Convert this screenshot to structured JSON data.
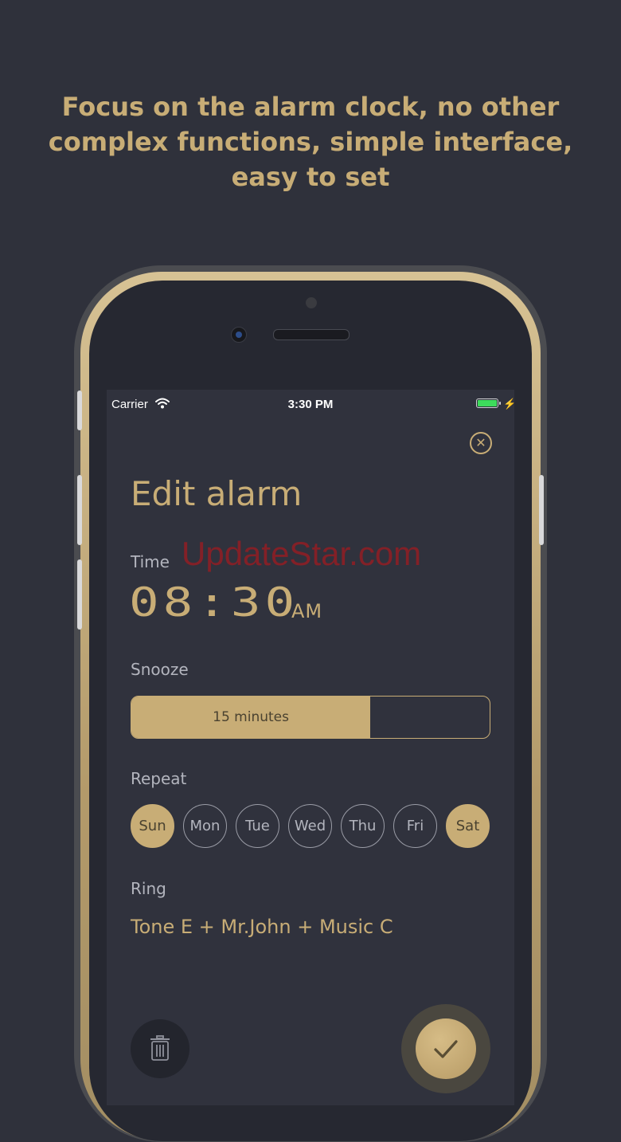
{
  "headline": {
    "line1": "Focus on the alarm clock, no other",
    "line2": "complex functions, simple interface,",
    "line3": "easy to set"
  },
  "status_bar": {
    "carrier": "Carrier",
    "time": "3:30 PM",
    "battery_level": 1.0,
    "charging": true
  },
  "screen": {
    "title": "Edit alarm",
    "time_label": "Time",
    "time_value": "08:30",
    "ampm": "AM",
    "snooze_label": "Snooze",
    "snooze_value": "15 minutes",
    "snooze_fill_fraction": 0.667,
    "repeat_label": "Repeat",
    "days": [
      {
        "label": "Sun",
        "selected": true
      },
      {
        "label": "Mon",
        "selected": false
      },
      {
        "label": "Tue",
        "selected": false
      },
      {
        "label": "Wed",
        "selected": false
      },
      {
        "label": "Thu",
        "selected": false
      },
      {
        "label": "Fri",
        "selected": false
      },
      {
        "label": "Sat",
        "selected": true
      }
    ],
    "ring_label": "Ring",
    "ring_value": "Tone E + Mr.John + Music C"
  },
  "watermark": "UpdateStar.com",
  "icons": {
    "close": "close-icon",
    "wifi": "wifi-icon",
    "battery": "battery-icon",
    "trash": "trash-icon",
    "confirm": "check-icon"
  },
  "colors": {
    "accent": "#c8ad76",
    "background": "#2f313b",
    "screen": "#30323d",
    "muted_text": "#b3b5be"
  }
}
